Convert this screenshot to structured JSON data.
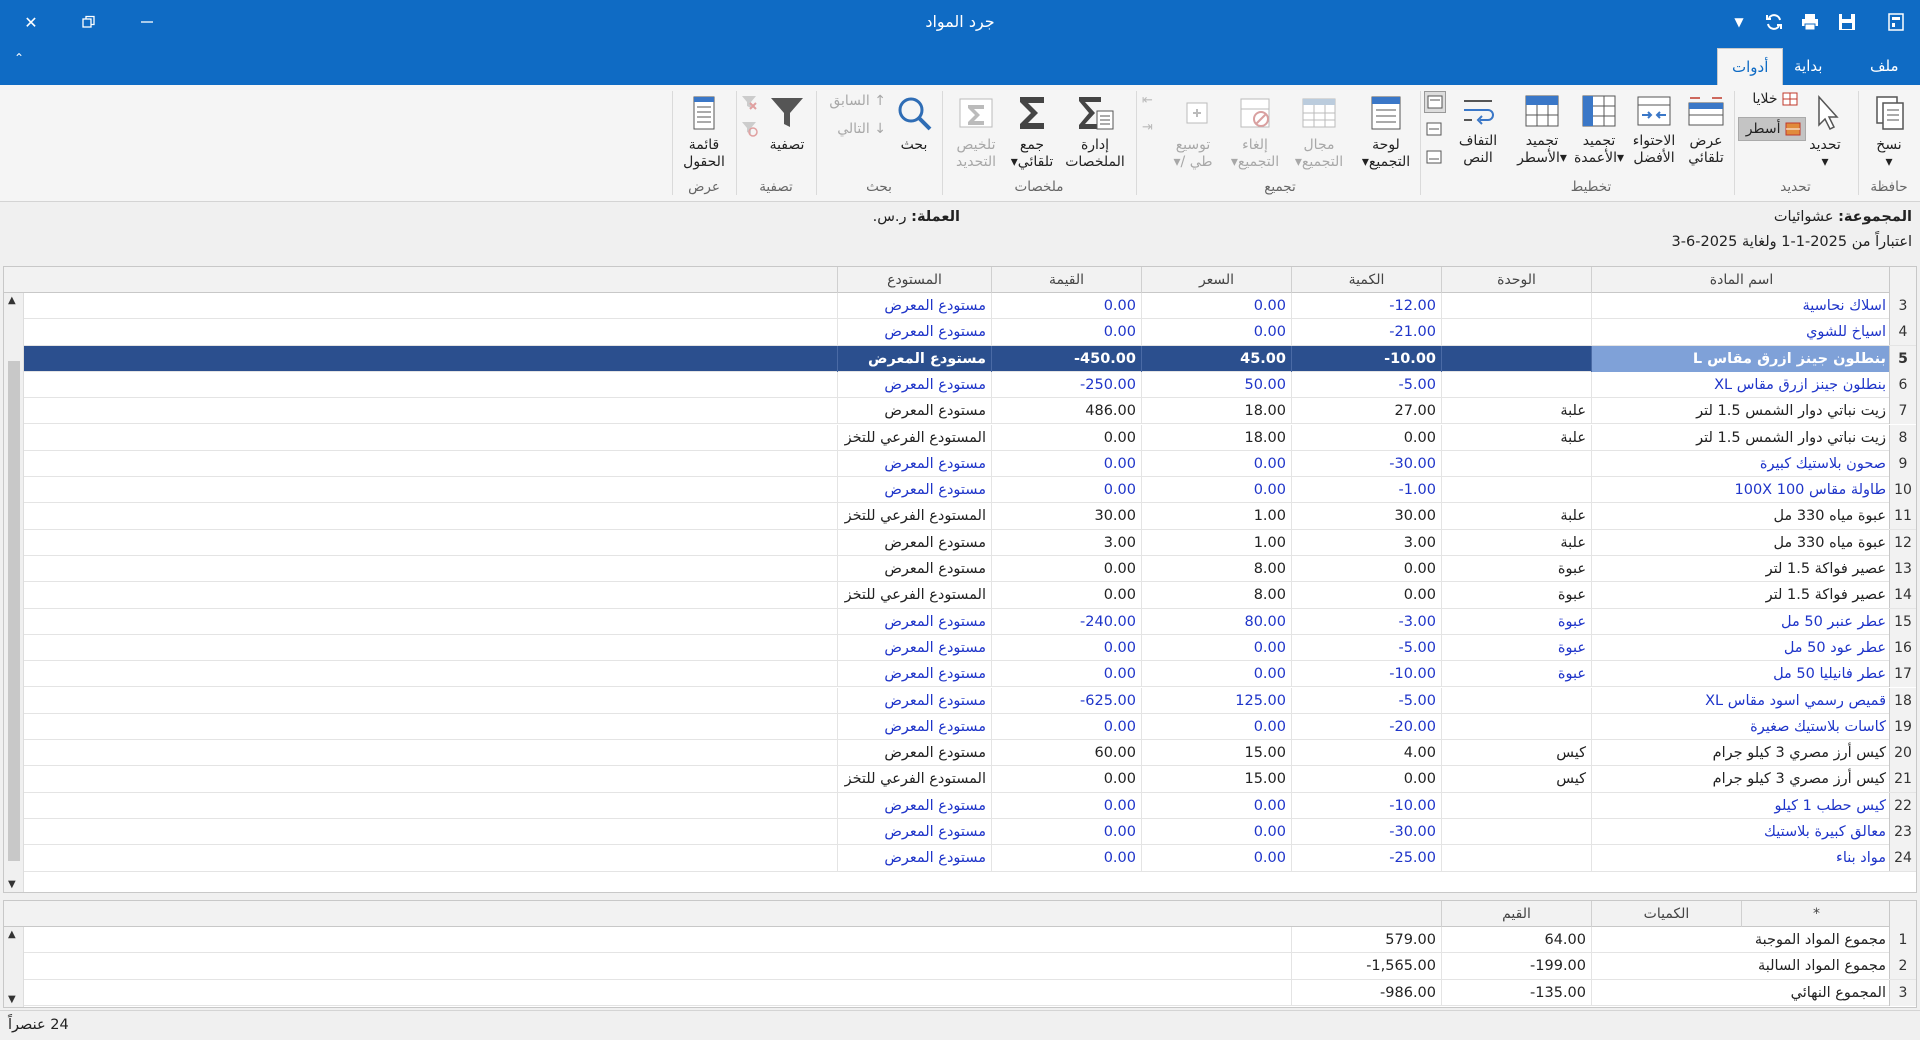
{
  "window": {
    "title": "جرد المواد"
  },
  "tabs": [
    {
      "label": "ملف"
    },
    {
      "label": "بداية"
    },
    {
      "label": "أدوات"
    }
  ],
  "ribbon": {
    "clipboard": {
      "group": "حافظة",
      "copy": "نسخ"
    },
    "select": {
      "group": "تحديد",
      "select": "تحديد",
      "cells": "خلايا",
      "rows": "أسطر"
    },
    "layout": {
      "group": "تخطيط",
      "autofit_l1": "عرض",
      "autofit_l2": "تلقائي",
      "bestfit_l1": "الاحتواء",
      "bestfit_l2": "الأفضل",
      "freezecol_l1": "تجميد",
      "freezecol_l2": "الأعمدة",
      "freezerow_l1": "تجميد",
      "freezerow_l2": "الأسطر",
      "wrap_l1": "التفاف",
      "wrap_l2": "النص"
    },
    "grouping": {
      "group": "تجميع",
      "panel_l1": "لوحة",
      "panel_l2": "التجميع",
      "range_l1": "مجال",
      "range_l2": "التجميع",
      "cancel_l1": "إلغاء",
      "cancel_l2": "التجميع",
      "expand_l1": "توسيع",
      "expand_l2": "/ طي"
    },
    "summaries": {
      "group": "ملخصات",
      "manage_l1": "إدارة",
      "manage_l2": "الملخصات",
      "autosum_l1": "جمع",
      "autosum_l2": "تلقائي",
      "sumsel_l1": "تلخيص",
      "sumsel_l2": "التحديد"
    },
    "search": {
      "group": "بحث",
      "search": "بحث",
      "prev": "السابق",
      "next": "التالي"
    },
    "filter": {
      "group": "تصفية",
      "filter": "تصفية"
    },
    "view": {
      "group": "عرض",
      "fields_l1": "قائمة",
      "fields_l2": "الحقول"
    }
  },
  "info": {
    "group_label": "المجموعة:",
    "group_value": "عشوائيات",
    "currency_label": "العملة:",
    "currency_value": "ر.س.",
    "date_text": "اعتباراً من  2025-1-1 ولغاية  2025-6-3"
  },
  "grid": {
    "columns": [
      "اسم المادة",
      "الوحدة",
      "الكمية",
      "السعر",
      "القيمة",
      "المستودع"
    ],
    "rows": [
      {
        "n": "3",
        "name": "اسلاك نحاسية",
        "unit": "",
        "qty": "-12.00",
        "price": "0.00",
        "value": "0.00",
        "wh": "مستودع المعرض",
        "neg": true
      },
      {
        "n": "4",
        "name": "اسياخ للشوي",
        "unit": "",
        "qty": "-21.00",
        "price": "0.00",
        "value": "0.00",
        "wh": "مستودع المعرض",
        "neg": true
      },
      {
        "n": "5",
        "name": "بنطلون جينز ازرق مقاس L",
        "unit": "",
        "qty": "-10.00",
        "price": "45.00",
        "value": "-450.00",
        "wh": "مستودع المعرض",
        "neg": true,
        "sel": true
      },
      {
        "n": "6",
        "name": "بنطلون جينز ازرق مقاس XL",
        "unit": "",
        "qty": "-5.00",
        "price": "50.00",
        "value": "-250.00",
        "wh": "مستودع المعرض",
        "neg": true
      },
      {
        "n": "7",
        "name": "زيت نباتي دوار الشمس 1.5 لتر",
        "unit": "علبة",
        "qty": "27.00",
        "price": "18.00",
        "value": "486.00",
        "wh": "مستودع المعرض",
        "neg": false
      },
      {
        "n": "8",
        "name": "زيت نباتي دوار الشمس 1.5 لتر",
        "unit": "علبة",
        "qty": "0.00",
        "price": "18.00",
        "value": "0.00",
        "wh": "المستودع الفرعي للتخز",
        "neg": false
      },
      {
        "n": "9",
        "name": "صحون بلاستيك كبيرة",
        "unit": "",
        "qty": "-30.00",
        "price": "0.00",
        "value": "0.00",
        "wh": "مستودع المعرض",
        "neg": true
      },
      {
        "n": "10",
        "name": "طاولة مقاس 100X 100",
        "unit": "",
        "qty": "-1.00",
        "price": "0.00",
        "value": "0.00",
        "wh": "مستودع المعرض",
        "neg": true
      },
      {
        "n": "11",
        "name": "عبوة مياه 330 مل",
        "unit": "علبة",
        "qty": "30.00",
        "price": "1.00",
        "value": "30.00",
        "wh": "المستودع الفرعي للتخز",
        "neg": false
      },
      {
        "n": "12",
        "name": "عبوة مياه 330 مل",
        "unit": "علبة",
        "qty": "3.00",
        "price": "1.00",
        "value": "3.00",
        "wh": "مستودع المعرض",
        "neg": false
      },
      {
        "n": "13",
        "name": "عصير فواكة 1.5 لتر",
        "unit": "عبوة",
        "qty": "0.00",
        "price": "8.00",
        "value": "0.00",
        "wh": "مستودع المعرض",
        "neg": false
      },
      {
        "n": "14",
        "name": "عصير فواكة 1.5 لتر",
        "unit": "عبوة",
        "qty": "0.00",
        "price": "8.00",
        "value": "0.00",
        "wh": "المستودع الفرعي للتخز",
        "neg": false
      },
      {
        "n": "15",
        "name": "عطر عنبر 50 مل",
        "unit": "عبوة",
        "qty": "-3.00",
        "price": "80.00",
        "value": "-240.00",
        "wh": "مستودع المعرض",
        "neg": true
      },
      {
        "n": "16",
        "name": "عطر عود 50 مل",
        "unit": "عبوة",
        "qty": "-5.00",
        "price": "0.00",
        "value": "0.00",
        "wh": "مستودع المعرض",
        "neg": true
      },
      {
        "n": "17",
        "name": "عطر فانيليا 50 مل",
        "unit": "عبوة",
        "qty": "-10.00",
        "price": "0.00",
        "value": "0.00",
        "wh": "مستودع المعرض",
        "neg": true
      },
      {
        "n": "18",
        "name": "قميص رسمي اسود مقاس XL",
        "unit": "",
        "qty": "-5.00",
        "price": "125.00",
        "value": "-625.00",
        "wh": "مستودع المعرض",
        "neg": true
      },
      {
        "n": "19",
        "name": "كاسات بلاستيك صغيرة",
        "unit": "",
        "qty": "-20.00",
        "price": "0.00",
        "value": "0.00",
        "wh": "مستودع المعرض",
        "neg": true
      },
      {
        "n": "20",
        "name": "كيس أرز مصري 3 كيلو جرام",
        "unit": "كيس",
        "qty": "4.00",
        "price": "15.00",
        "value": "60.00",
        "wh": "مستودع المعرض",
        "neg": false
      },
      {
        "n": "21",
        "name": "كيس أرز مصري 3 كيلو جرام",
        "unit": "كيس",
        "qty": "0.00",
        "price": "15.00",
        "value": "0.00",
        "wh": "المستودع الفرعي للتخز",
        "neg": false
      },
      {
        "n": "22",
        "name": "كيس حطب 1 كيلو",
        "unit": "",
        "qty": "-10.00",
        "price": "0.00",
        "value": "0.00",
        "wh": "مستودع المعرض",
        "neg": true
      },
      {
        "n": "23",
        "name": "معالق كبيرة بلاستيك",
        "unit": "",
        "qty": "-30.00",
        "price": "0.00",
        "value": "0.00",
        "wh": "مستودع المعرض",
        "neg": true
      },
      {
        "n": "24",
        "name": "مواد بناء",
        "unit": "",
        "qty": "-25.00",
        "price": "0.00",
        "value": "0.00",
        "wh": "مستودع المعرض",
        "neg": true
      }
    ]
  },
  "summary": {
    "columns": [
      "*",
      "الكميات",
      "القيم"
    ],
    "rows": [
      {
        "n": "1",
        "label": "مجموع المواد الموجبة",
        "qty": "64.00",
        "value": "579.00"
      },
      {
        "n": "2",
        "label": "مجموع المواد السالبة",
        "qty": "-199.00",
        "value": "-1,565.00"
      },
      {
        "n": "3",
        "label": "المجموع النهائي",
        "qty": "-135.00",
        "value": "-986.00"
      }
    ]
  },
  "status": {
    "count_text": "24 عنصراً"
  },
  "colors": {
    "titlebar": "#0f6bc4",
    "negative_text": "#1f35c9",
    "selected_row": "#2b4f8e",
    "selected_name_cell": "#7fa1d8"
  }
}
